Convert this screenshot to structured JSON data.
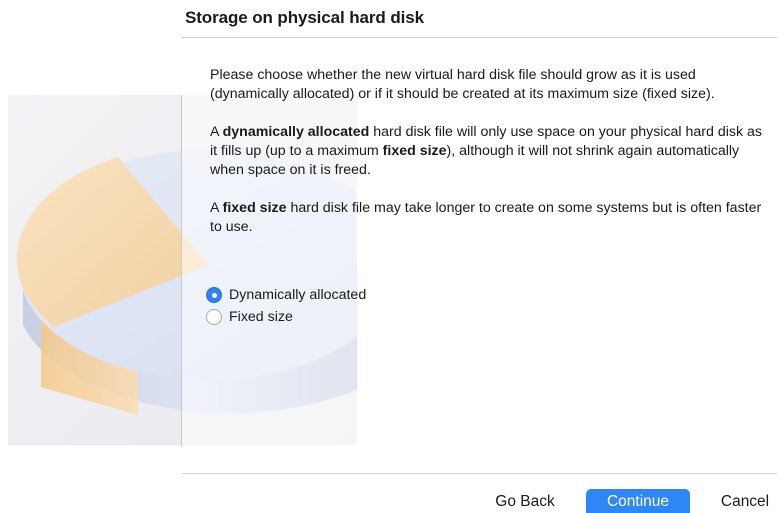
{
  "header": {
    "title": "Storage on physical hard disk"
  },
  "body": {
    "para1": "Please choose whether the new virtual hard disk file should grow as it is used (dynamically allocated) or if it should be created at its maximum size (fixed size).",
    "para2": {
      "t1": "A ",
      "b1": "dynamically allocated",
      "t2": " hard disk file will only use space on your physical hard disk as it fills up (up to a maximum ",
      "b2": "fixed size",
      "t3": "), although it will not shrink again automatically when space on it is freed."
    },
    "para3": {
      "t1": "A ",
      "b1": "fixed size",
      "t2": " hard disk file may take longer to create on some systems but is often faster to use."
    }
  },
  "options": {
    "dynamic_label": "Dynamically allocated",
    "fixed_label": "Fixed size",
    "selected": "Dynamically allocated"
  },
  "buttons": {
    "back": "Go Back",
    "continue": "Continue",
    "cancel": "Cancel"
  },
  "colors": {
    "accent": "#2f80f0"
  },
  "icons": {
    "illustration": "hard-disk-illustration"
  }
}
